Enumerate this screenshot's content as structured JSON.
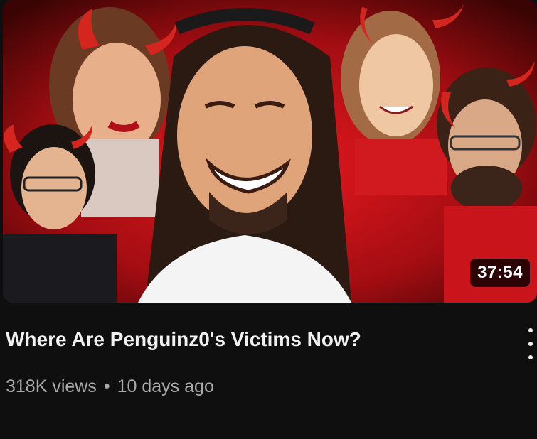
{
  "video": {
    "title": "Where Are Penguinz0's Victims Now?",
    "duration": "37:54",
    "views": "318K views",
    "separator": "•",
    "age": "10 days ago"
  },
  "thumbnail": {
    "description_icon": "thumbnail-illustration",
    "colors": {
      "background_dark": "#3a0404",
      "background_red": "#c8141a",
      "horn_red": "#d4261e"
    }
  },
  "menu": {
    "icon": "more-vert-icon"
  }
}
